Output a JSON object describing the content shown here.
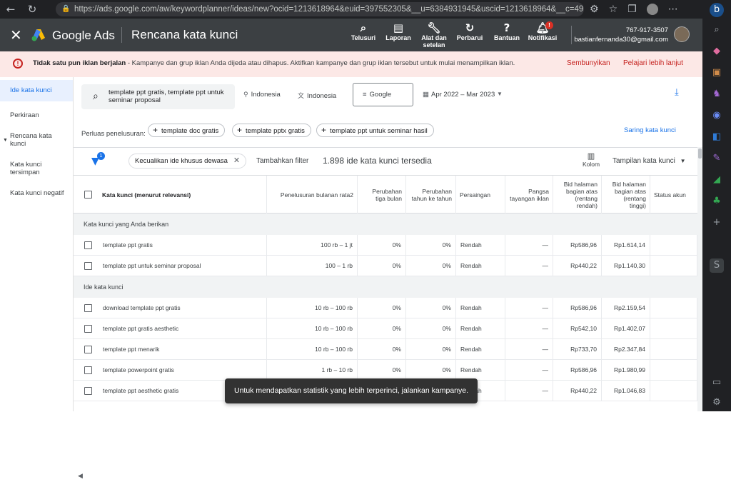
{
  "browser": {
    "url": "https://ads.google.com/aw/keywordplanner/ideas/new?ocid=1213618964&euid=397552305&__u=6384931945&uscid=1213618964&__c=49..."
  },
  "header": {
    "close_icon": "close-icon",
    "product_name": "Google Ads",
    "page_title": "Rencana kata kunci",
    "tools": [
      {
        "label": "Telusuri",
        "icon": "search-icon"
      },
      {
        "label": "Laporan",
        "icon": "report-icon"
      },
      {
        "label": "Alat dan setelan",
        "icon": "wrench-icon"
      },
      {
        "label": "Perbarui",
        "icon": "refresh-icon"
      },
      {
        "label": "Bantuan",
        "icon": "help-icon"
      },
      {
        "label": "Notifikasi",
        "icon": "bell-icon",
        "badge": "!"
      }
    ],
    "phone": "767-917-3507",
    "email": "bastianfernanda30@gmail.com"
  },
  "alert": {
    "title": "Tidak satu pun iklan berjalan",
    "message": " - Kampanye dan grup iklan Anda dijeda atau dihapus. Aktifkan kampanye dan grup iklan tersebut untuk mulai menampilkan iklan.",
    "hide_label": "Sembunyikan",
    "learn_label": "Pelajari lebih lanjut"
  },
  "sidebar": {
    "items": [
      {
        "label": "Ide kata kunci"
      },
      {
        "label": "Perkiraan"
      },
      {
        "label": "Rencana kata kunci"
      },
      {
        "label": "Kata kunci tersimpan"
      },
      {
        "label": "Kata kunci negatif"
      }
    ]
  },
  "filters": {
    "search_text": "template ppt gratis, template ppt untuk seminar proposal",
    "location": "Indonesia",
    "language": "Indonesia",
    "network": "Google",
    "date_range": "Apr 2022 – Mar 2023"
  },
  "broaden": {
    "label": "Perluas penelusuran:",
    "chips": [
      "template doc gratis",
      "template pptx gratis",
      "template ppt untuk seminar hasil"
    ],
    "refine_label": "Saring kata kunci"
  },
  "toolbar": {
    "filter_badge": "1",
    "exclude_chip": "Kecualikan ide khusus dewasa",
    "add_filter": "Tambahkan filter",
    "idea_count": "1.898 ide kata kunci tersedia",
    "columns_label": "Kolom",
    "view_label": "Tampilan kata kunci"
  },
  "table": {
    "headers": {
      "keyword": "Kata kunci (menurut relevansi)",
      "searches": "Penelusuran bulanan rata2",
      "three_month": "Perubahan tiga bulan",
      "yoy": "Perubahan tahun ke tahun",
      "competition": "Persaingan",
      "impression_share": "Pangsa tayangan iklan",
      "bid_low": "Bid halaman bagian atas (rentang rendah)",
      "bid_high": "Bid halaman bagian atas (rentang tinggi)",
      "status": "Status akun"
    },
    "group1": "Kata kunci yang Anda berikan",
    "provided": [
      {
        "kw": "template ppt gratis",
        "searches": "100 rb – 1 jt",
        "m3": "0%",
        "yoy": "0%",
        "comp": "Rendah",
        "share": "—",
        "low": "Rp586,96",
        "high": "Rp1.614,14"
      },
      {
        "kw": "template ppt untuk seminar proposal",
        "searches": "100 – 1 rb",
        "m3": "0%",
        "yoy": "0%",
        "comp": "Rendah",
        "share": "—",
        "low": "Rp440,22",
        "high": "Rp1.140,30"
      }
    ],
    "group2": "Ide kata kunci",
    "ideas": [
      {
        "kw": "download template ppt gratis",
        "searches": "10 rb – 100 rb",
        "m3": "0%",
        "yoy": "0%",
        "comp": "Rendah",
        "share": "—",
        "low": "Rp586,96",
        "high": "Rp2.159,54"
      },
      {
        "kw": "template ppt gratis aesthetic",
        "searches": "10 rb – 100 rb",
        "m3": "0%",
        "yoy": "0%",
        "comp": "Rendah",
        "share": "—",
        "low": "Rp542,10",
        "high": "Rp1.402,07"
      },
      {
        "kw": "template ppt menarik",
        "searches": "10 rb – 100 rb",
        "m3": "0%",
        "yoy": "0%",
        "comp": "Rendah",
        "share": "—",
        "low": "Rp733,70",
        "high": "Rp2.347,84"
      },
      {
        "kw": "template powerpoint gratis",
        "searches": "1 rb – 10 rb",
        "m3": "0%",
        "yoy": "0%",
        "comp": "Rendah",
        "share": "—",
        "low": "Rp586,96",
        "high": "Rp1.980,99"
      },
      {
        "kw": "template ppt aesthetic gratis",
        "searches": "",
        "m3": "",
        "yoy": "",
        "comp": "Rendah",
        "share": "—",
        "low": "Rp440,22",
        "high": "Rp1.046,83"
      }
    ]
  },
  "toast": {
    "message": "Untuk mendapatkan statistik yang lebih terperinci, jalankan kampanye."
  },
  "colors": {
    "accent": "#1a73e8",
    "header_bg": "#3c4043",
    "alert_bg": "#fce8e6",
    "alert_red": "#c5221f"
  }
}
